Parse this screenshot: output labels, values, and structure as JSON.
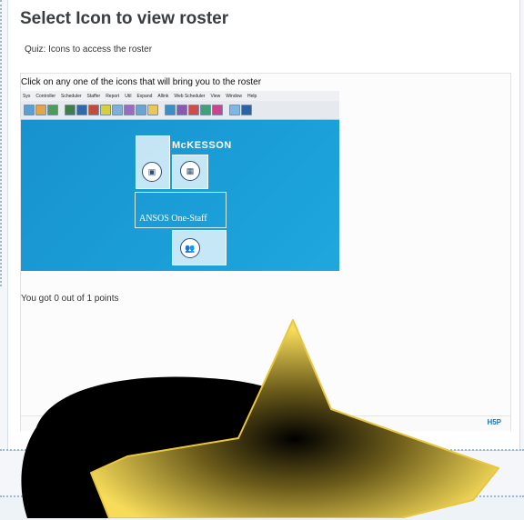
{
  "page": {
    "title": "Select Icon to view roster",
    "subtitle": "Quiz: Icons to access the roster"
  },
  "quiz": {
    "instruction": "Click on any one of the icons that will bring you to the roster",
    "score_text": "You got 0 out of 1 points",
    "footer_logo": "H5P"
  },
  "app_screenshot": {
    "menu_items": [
      "Sys",
      "Controller",
      "Scheduler",
      "Staffer",
      "Report",
      "Util",
      "Expand",
      "Allink",
      "Web Scheduler",
      "View",
      "Window",
      "Help"
    ],
    "brand": "McKESSON",
    "product": "ANSOS One-Staff"
  },
  "colors": {
    "app_blue": "#1b9bd6",
    "star_yellow": "#f7dc5a",
    "title_gray": "#3a3d40"
  }
}
